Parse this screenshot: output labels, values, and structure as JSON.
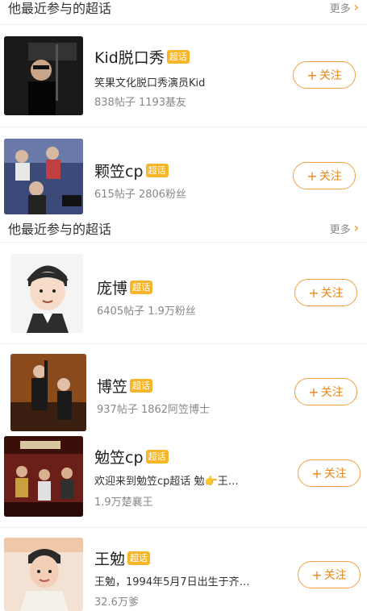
{
  "section": {
    "title": "他最近参与的超话",
    "more": "更多"
  },
  "follow_label": "关注",
  "badge": "超话",
  "top_items": [
    {
      "name": "Kid脱口秀",
      "desc": "笑果文化脱口秀演员Kid",
      "stats": "838帖子 1193基友"
    },
    {
      "name": "颗笠cp",
      "stats": "615帖子 2806粉丝"
    }
  ],
  "items": [
    {
      "name": "庞博",
      "stats": "6405帖子 1.9万粉丝"
    },
    {
      "name": "博笠",
      "stats": "937帖子 1862阿笠博士"
    },
    {
      "name": "勉笠cp",
      "desc": "欢迎来到勉笠cp超话 勉👉王…",
      "stats": "1.9万楚襄王"
    },
    {
      "name": "王勉",
      "desc": "王勉，1994年5月7日出生于齐…",
      "stats": "32.6万爹"
    }
  ],
  "colors": {
    "accent": "#f08a24",
    "badge": "#f7b52a"
  }
}
